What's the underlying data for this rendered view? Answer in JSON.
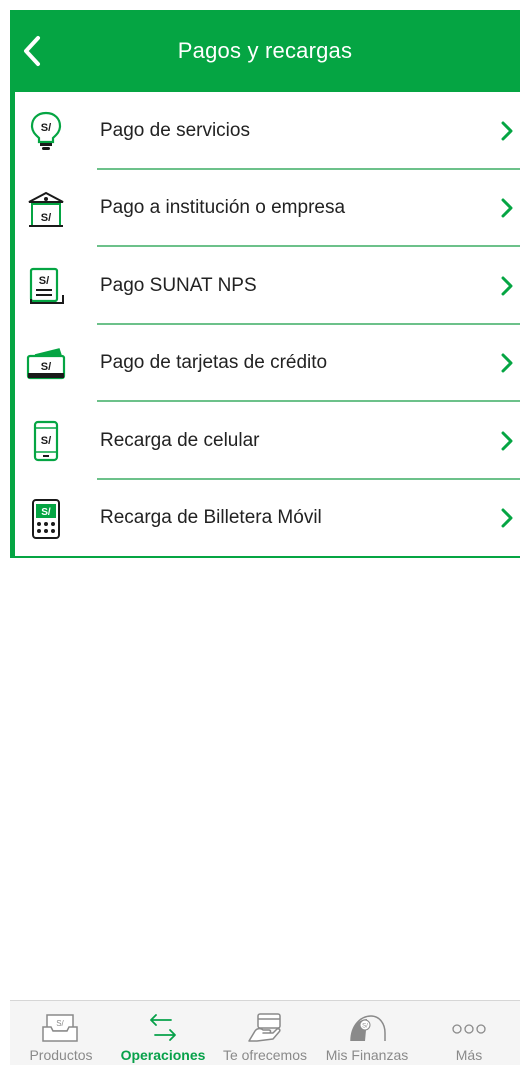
{
  "header": {
    "title": "Pagos y recargas",
    "back_icon": "chevron-left-icon"
  },
  "menu": {
    "items": [
      {
        "label": "Pago de servicios",
        "icon": "lightbulb-soles-icon"
      },
      {
        "label": "Pago a institución o empresa",
        "icon": "institution-soles-icon"
      },
      {
        "label": "Pago SUNAT NPS",
        "icon": "document-soles-icon"
      },
      {
        "label": "Pago de tarjetas de crédito",
        "icon": "credit-card-soles-icon"
      },
      {
        "label": "Recarga de celular",
        "icon": "phone-soles-icon"
      },
      {
        "label": "Recarga de Billetera Móvil",
        "icon": "wallet-phone-icon"
      }
    ],
    "chevron_icon": "chevron-right-icon",
    "currency_symbol": "S/"
  },
  "tabbar": {
    "tabs": [
      {
        "label": "Productos",
        "icon": "wallet-icon",
        "active": false
      },
      {
        "label": "Operaciones",
        "icon": "transfer-arrows-icon",
        "active": true
      },
      {
        "label": "Te ofrecemos",
        "icon": "hand-card-icon",
        "active": false
      },
      {
        "label": "Mis Finanzas",
        "icon": "gauge-icon",
        "active": false
      },
      {
        "label": "Más",
        "icon": "more-dots-icon",
        "active": false
      }
    ]
  },
  "colors": {
    "brand_green": "#05a543",
    "divider_green": "#6cc18a",
    "active_tab": "#07a14a",
    "inactive_tab": "#8a8a8a"
  }
}
